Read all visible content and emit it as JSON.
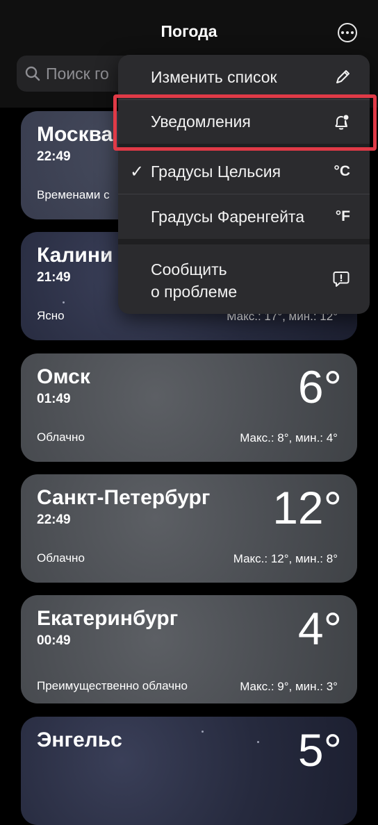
{
  "header": {
    "title": "Погода"
  },
  "search": {
    "placeholder": "Поиск го"
  },
  "cities": [
    {
      "name": "Москва",
      "time": "22:49",
      "condition": "Временами с",
      "temp": "",
      "hilo": ""
    },
    {
      "name": "Калини",
      "time": "21:49",
      "condition": "Ясно",
      "temp": "",
      "hilo": "Макс.: 17°, мин.: 12°"
    },
    {
      "name": "Омск",
      "time": "01:49",
      "condition": "Облачно",
      "temp": "6°",
      "hilo": "Макс.: 8°, мин.: 4°"
    },
    {
      "name": "Санкт-Петербург",
      "time": "22:49",
      "condition": "Облачно",
      "temp": "12°",
      "hilo": "Макс.: 12°, мин.: 8°"
    },
    {
      "name": "Екатеринбург",
      "time": "00:49",
      "condition": "Преимущественно облачно",
      "temp": "4°",
      "hilo": "Макс.: 9°, мин.: 3°"
    },
    {
      "name": "Энгельс",
      "time": "",
      "condition": "",
      "temp": "5°",
      "hilo": ""
    }
  ],
  "menu": {
    "edit_list": "Изменить список",
    "notifications": "Уведомления",
    "celsius": "Градусы Цельсия",
    "celsius_checkmark": "✓",
    "celsius_unit": "°C",
    "fahrenheit": "Градусы Фаренгейта",
    "fahrenheit_unit": "°F",
    "report_line1": "Сообщить",
    "report_line2": "о проблеме",
    "icons": [
      "pencil-icon",
      "bell-badge-icon",
      "exclamation-bubble-icon"
    ]
  },
  "colors": {
    "highlight": "#e03a47",
    "menu_bg": "#2b2b2e"
  }
}
